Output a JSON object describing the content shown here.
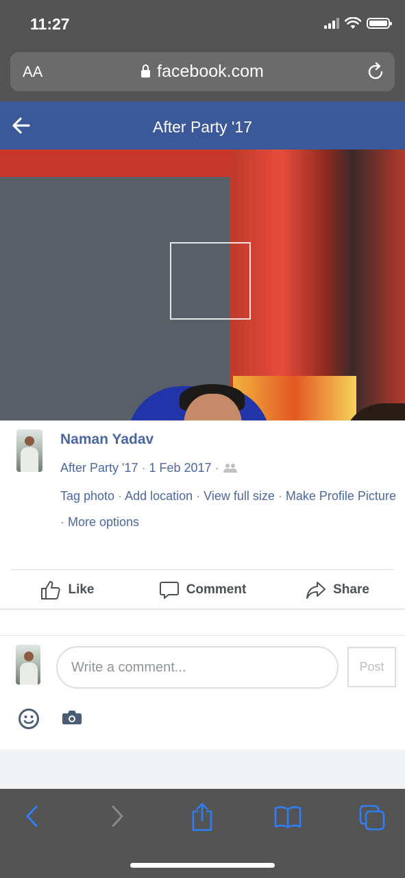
{
  "status_bar": {
    "time": "11:27"
  },
  "browser": {
    "text_size_label": "AA",
    "domain": "facebook.com"
  },
  "header": {
    "title": "After Party '17"
  },
  "post": {
    "author": "Naman Yadav",
    "album": "After Party '17",
    "date": "1 Feb 2017",
    "audience_icon": "friends-icon",
    "links": {
      "tag_photo": "Tag photo",
      "add_location": "Add location",
      "view_full_size": "View full size",
      "make_profile_picture": "Make Profile Picture",
      "more_options": "More options"
    }
  },
  "actions": {
    "like": "Like",
    "comment": "Comment",
    "share": "Share"
  },
  "comment_box": {
    "placeholder": "Write a comment...",
    "post_label": "Post"
  },
  "colors": {
    "facebook_blue": "#3b5998",
    "link_blue": "#4b67a1",
    "safari_blue": "#2d7ff9",
    "chrome_grey": "#545454"
  }
}
